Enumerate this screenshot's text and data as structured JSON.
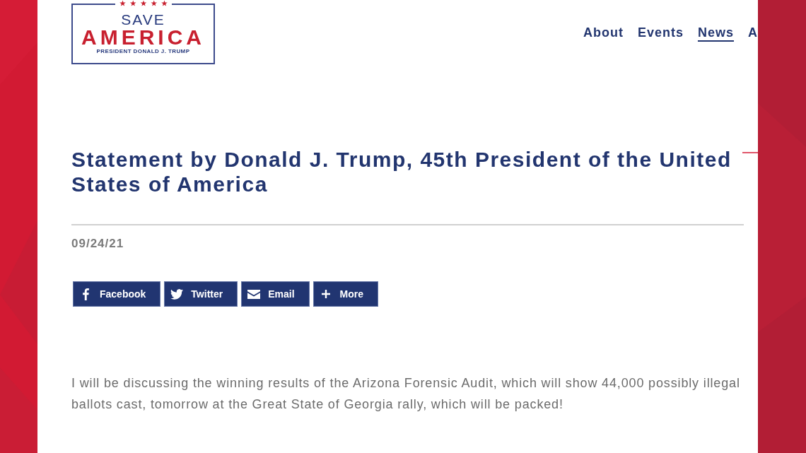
{
  "header": {
    "logo": {
      "top_line": "SAVE",
      "main_line": "AMERICA",
      "tagline": "PRESIDENT DONALD J. TRUMP"
    },
    "nav": [
      {
        "label": "About",
        "selected": false
      },
      {
        "label": "Events",
        "selected": false
      },
      {
        "label": "News",
        "selected": true
      },
      {
        "label": "A",
        "selected": false
      }
    ]
  },
  "article": {
    "title": "Statement by Donald J. Trump, 45th President of the United States of America",
    "date": "09/24/21",
    "share_buttons": [
      {
        "kind": "facebook",
        "label": "Facebook"
      },
      {
        "kind": "twitter",
        "label": "Twitter"
      },
      {
        "kind": "email",
        "label": "Email"
      },
      {
        "kind": "more",
        "label": "More"
      }
    ],
    "body": "I will be discussing the winning results of the Arizona Forensic Audit, which will show 44,000 possibly illegal ballots cast, tomorrow at the Great State of Georgia rally, which will be packed!"
  }
}
